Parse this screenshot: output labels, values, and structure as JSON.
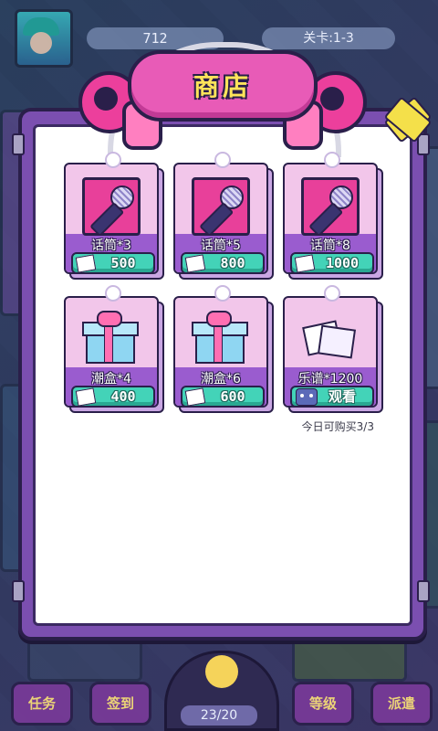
{
  "topbar": {
    "score": "712",
    "level": "关卡:1-3"
  },
  "shop": {
    "title": "商店",
    "daily_limit": "今日可购买3/3",
    "items": [
      {
        "label": "话筒*3",
        "price": "500",
        "type": "mic",
        "action": "buy"
      },
      {
        "label": "话筒*5",
        "price": "800",
        "type": "mic",
        "action": "buy"
      },
      {
        "label": "话筒*8",
        "price": "1000",
        "type": "mic",
        "action": "buy"
      },
      {
        "label": "潮盒*4",
        "price": "400",
        "type": "gift",
        "action": "buy"
      },
      {
        "label": "潮盒*6",
        "price": "600",
        "type": "gift",
        "action": "buy"
      },
      {
        "label": "乐谱*1200",
        "price": "观看",
        "type": "sheet",
        "action": "watch"
      }
    ]
  },
  "nav": {
    "tasks": "任务",
    "checkin": "签到",
    "counter": "23/20",
    "upgrade": "等级",
    "dispatch": "派遣"
  },
  "colors": {
    "panel": "#7b4fb0",
    "header": "#e85bb7",
    "title": "#ffe45a",
    "price_button": "#43d3b8"
  }
}
